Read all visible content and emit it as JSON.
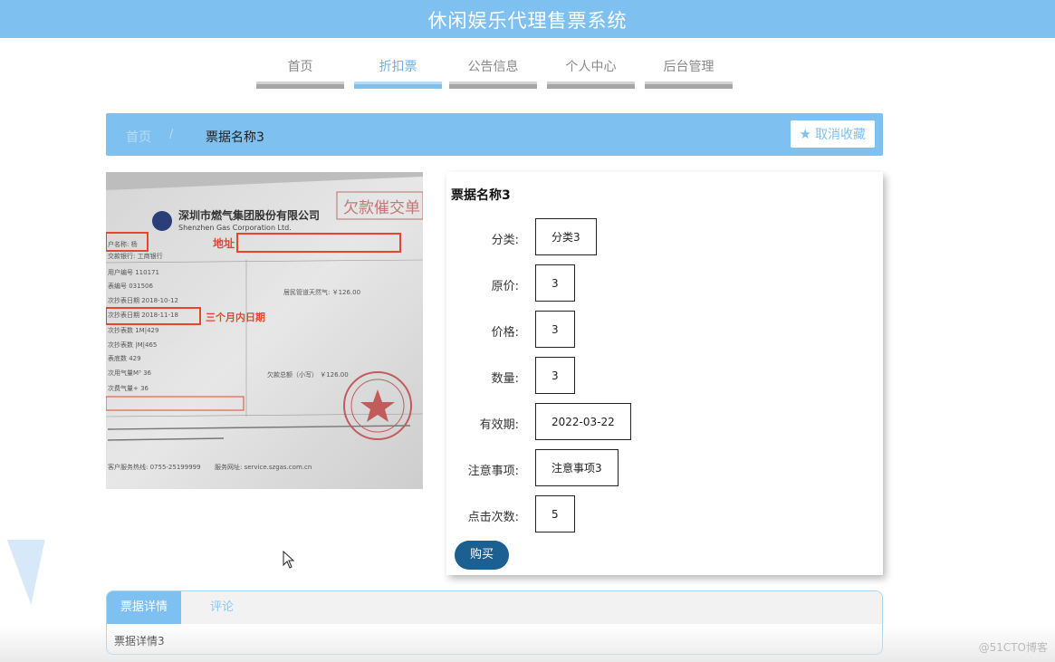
{
  "app": {
    "title": "休闲娱乐代理售票系统"
  },
  "nav": {
    "items": [
      {
        "label": "首页",
        "active": false
      },
      {
        "label": "折扣票",
        "active": true
      },
      {
        "label": "公告信息",
        "active": false
      },
      {
        "label": "个人中心",
        "active": false
      },
      {
        "label": "后台管理",
        "active": false
      }
    ]
  },
  "breadcrumb": {
    "home": "首页",
    "separator": "/",
    "current": "票据名称3"
  },
  "favorite_button": {
    "icon": "star-icon",
    "label": "取消收藏"
  },
  "ticket_photo": {
    "header_cn": "深圳市燃气集团股份有限公司",
    "header_en": "Shenzhen Gas Corporation Ltd.",
    "stamp_title": "欠款催交单",
    "annotation_address": "地址",
    "annotation_date": "三个月内日期",
    "lines": [
      "户名称: 杨",
      "交款银行: 工商银行",
      "用户编号 110171",
      "表编号 031506",
      "次抄表日期 2018-10-12",
      "次抄表日期 2018-11-18",
      "次抄表数 1M|429",
      "次抄表数 |M|465",
      "表底数 429",
      "次用气量M³ 36",
      "次费气量+ 36"
    ],
    "notice": "居民管道天然气: ￥126.00",
    "amount_label": "欠款总额（小写） ￥126.00",
    "hotline": "客户服务热线: 0755-25199999",
    "website": "服务网址: service.szgas.com.cn"
  },
  "detail": {
    "name": "票据名称3",
    "fields": [
      {
        "label": "分类:",
        "value": "分类3"
      },
      {
        "label": "原价:",
        "value": "3"
      },
      {
        "label": "价格:",
        "value": "3"
      },
      {
        "label": "数量:",
        "value": "3"
      },
      {
        "label": "有效期:",
        "value": "2022-03-22"
      },
      {
        "label": "注意事项:",
        "value": "注意事项3"
      },
      {
        "label": "点击次数:",
        "value": "5"
      }
    ],
    "buy_label": "购买"
  },
  "tabs": {
    "items": [
      {
        "label": "票据详情",
        "active": true
      },
      {
        "label": "评论",
        "active": false
      }
    ],
    "content": "票据详情3"
  },
  "watermark": "@51CTO博客",
  "colors": {
    "accent": "#7ec0f0",
    "buy": "#1c5f91",
    "annotation": "#e8452d"
  }
}
